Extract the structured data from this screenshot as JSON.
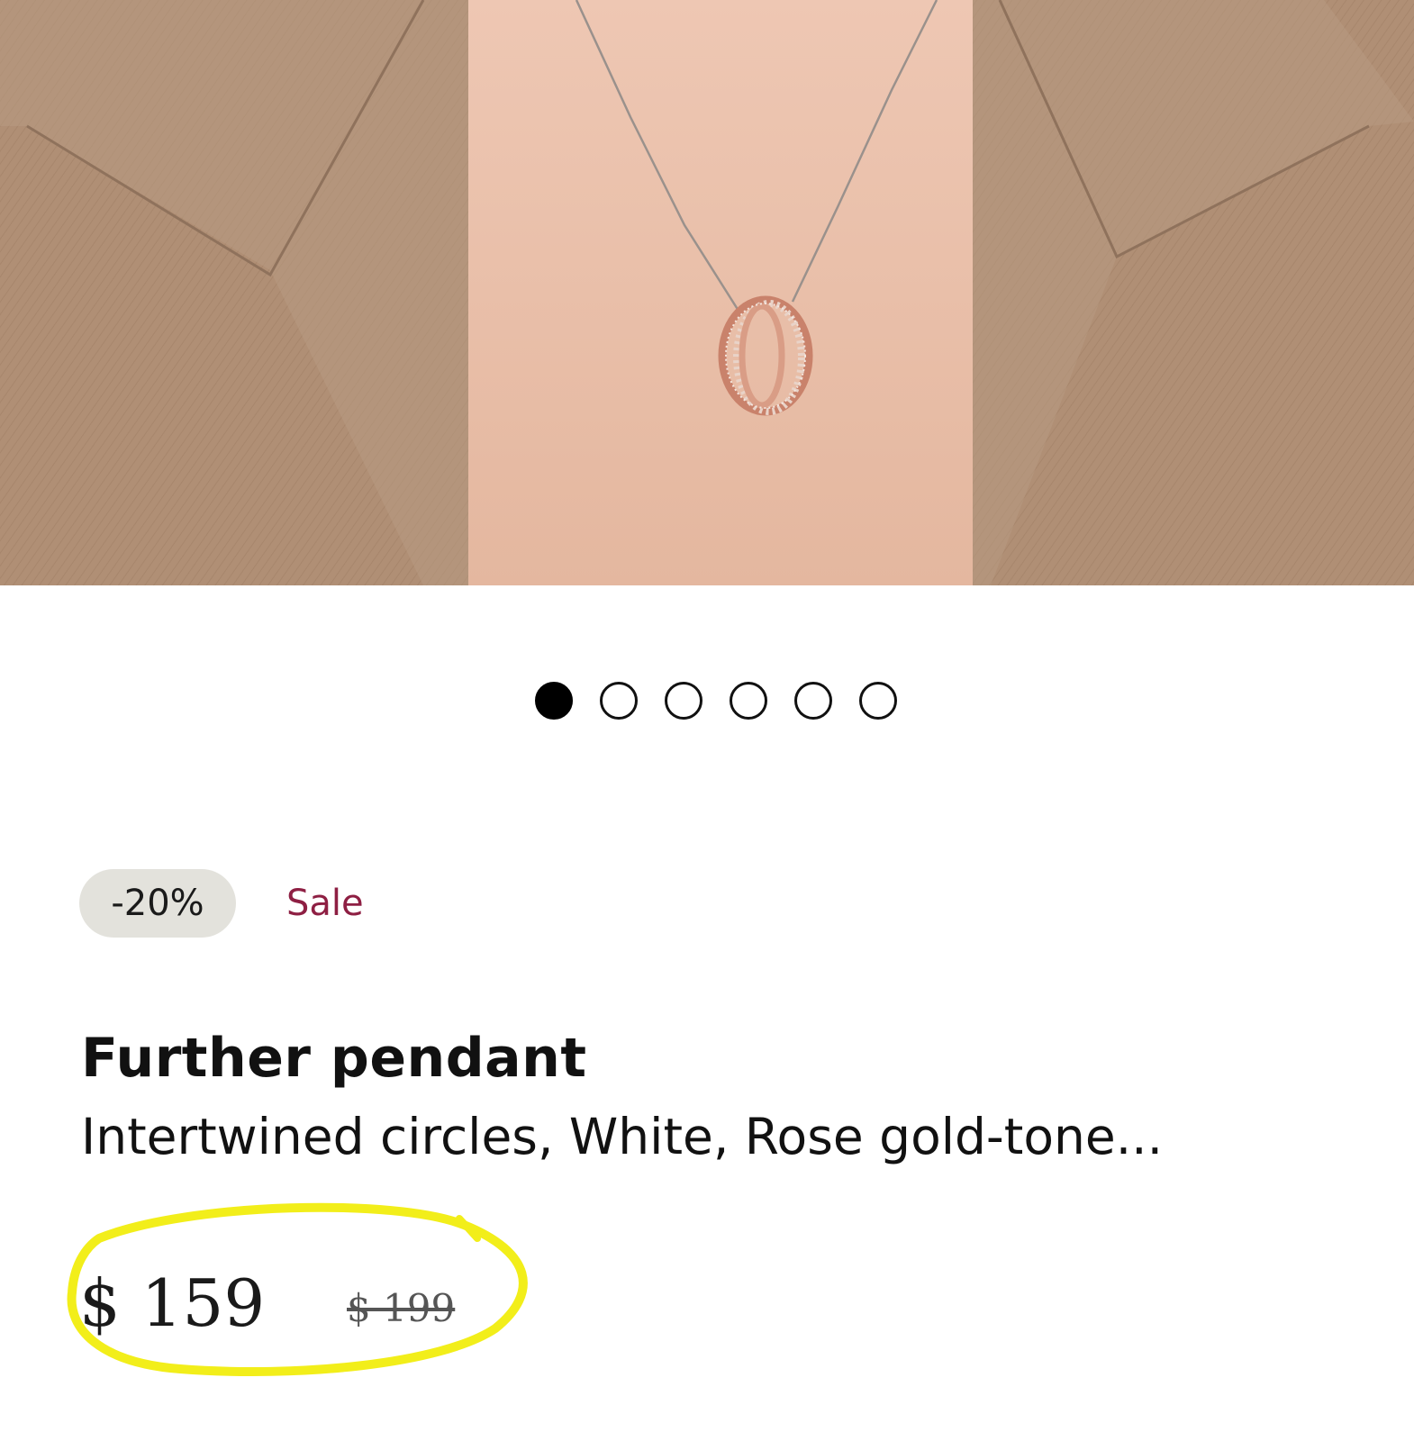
{
  "gallery": {
    "image_alt": "necklace-photo",
    "slides": [
      {
        "active": true
      },
      {
        "active": false
      },
      {
        "active": false
      },
      {
        "active": false
      },
      {
        "active": false
      },
      {
        "active": false
      }
    ]
  },
  "product": {
    "discount_badge": "-20%",
    "sale_label": "Sale",
    "title": "Further pendant",
    "subtitle": "Intertwined circles, White, Rose gold-tone...",
    "price": "$ 159",
    "original_price": "$ 199"
  },
  "colors": {
    "jacket": "#b08f75",
    "skin": "#e6bca6",
    "badge_bg": "#e3e2dc",
    "sale_text": "#8e1f43",
    "highlight": "#f2ee1a"
  }
}
